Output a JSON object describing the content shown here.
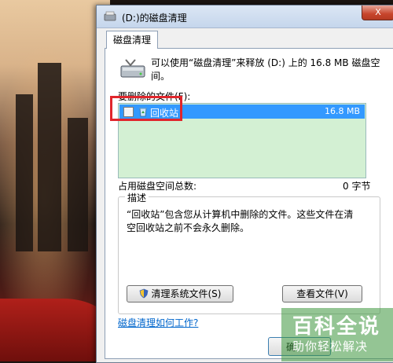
{
  "window": {
    "title": "(D:)的磁盘清理",
    "close_label": "X"
  },
  "tab": {
    "label": "磁盘清理"
  },
  "intro_text": "可以使用“磁盘清理”来释放 (D:) 上的 16.8 MB 磁盘空间。",
  "files_label": "要删除的文件(F):",
  "files": [
    {
      "checked": false,
      "name": "回收站",
      "size": "16.8 MB"
    }
  ],
  "total": {
    "label": "占用磁盘空间总数:",
    "value": "0 字节"
  },
  "description": {
    "group_title": "描述",
    "text": "“回收站”包含您从计算机中删除的文件。这些文件在清空回收站之前不会永久删除。"
  },
  "buttons": {
    "cleanup_system": "清理系统文件(S)",
    "view_files": "查看文件(V)",
    "ok_partial": "确"
  },
  "help_link": "磁盘清理如何工作?",
  "watermark": {
    "main": "百科全说",
    "sub": "助你轻松解决"
  },
  "colors": {
    "selection": "#3399ff",
    "list_bg": "#d3f0d3",
    "highlight": "#e0262c",
    "link": "#0066cc"
  }
}
